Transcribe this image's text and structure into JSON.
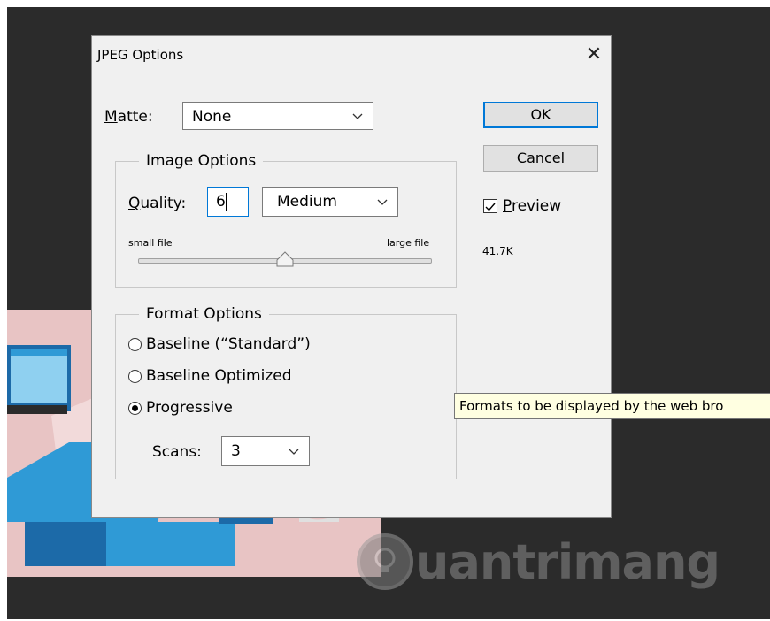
{
  "dialog": {
    "title": "JPEG Options",
    "close_icon": "close-icon"
  },
  "matte": {
    "label_first": "M",
    "label_rest": "atte:",
    "value": "None"
  },
  "image_options": {
    "legend": "Image Options",
    "quality_label_first": "Q",
    "quality_label_rest": "uality:",
    "quality_value": "6",
    "quality_preset": "Medium",
    "slider_min_label": "small file",
    "slider_max_label": "large file",
    "slider_fraction": 0.5
  },
  "buttons": {
    "ok": "OK",
    "cancel": "Cancel"
  },
  "preview": {
    "checked": true,
    "label_first": "P",
    "label_rest": "review",
    "file_size": "41.7K"
  },
  "format_options": {
    "legend": "Format Options",
    "options": [
      {
        "label": "Baseline (“Standard”)",
        "selected": false
      },
      {
        "label": "Baseline Optimized",
        "selected": false
      },
      {
        "label": "Progressive",
        "selected": true
      }
    ],
    "scans_label": "Scans:",
    "scans_value": "3"
  },
  "tooltip": {
    "text": "Formats to be displayed by the web bro"
  },
  "watermark": {
    "text": "uantrimang"
  },
  "colors": {
    "dialog_bg": "#f0f0f0",
    "workspace_bg": "#2b2b2b",
    "art_pink": "#e8c4c4",
    "art_blue": "#2f9ad6",
    "art_dark_blue": "#1c6aa8",
    "focus_blue": "#0078d7",
    "tooltip_bg": "#ffffe1"
  }
}
